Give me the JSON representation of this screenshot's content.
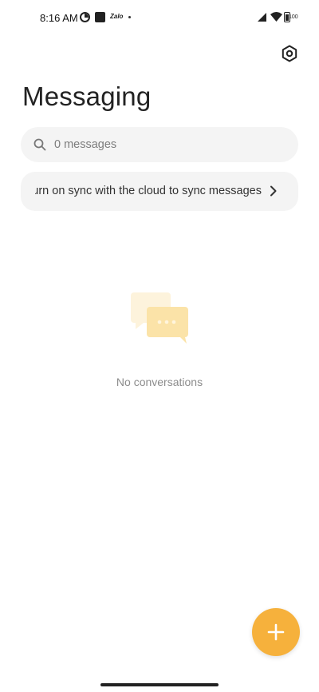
{
  "status_bar": {
    "time": "8:16 AM",
    "app_label": "Zalo",
    "battery_text": "100",
    "icons": [
      "status-circle-icon",
      "status-square-icon",
      "zalo-icon",
      "notification-dot-icon",
      "signal-icon",
      "wifi-icon",
      "battery-icon"
    ]
  },
  "header": {
    "title": "Messaging",
    "settings_icon": "settings-hexagon-icon"
  },
  "search": {
    "placeholder": "0 messages",
    "icon": "search-icon"
  },
  "sync_banner": {
    "text": "Turn on sync with the cloud to sync messages",
    "icon": "chevron-right-icon"
  },
  "empty_state": {
    "icon": "chat-bubbles-icon",
    "text": "No conversations"
  },
  "fab": {
    "icon": "plus-icon"
  },
  "colors": {
    "accent": "#f6b13c",
    "surface": "#f4f4f4",
    "empty_icon_light": "#fdf3dc",
    "empty_icon": "#fbe3a8"
  }
}
